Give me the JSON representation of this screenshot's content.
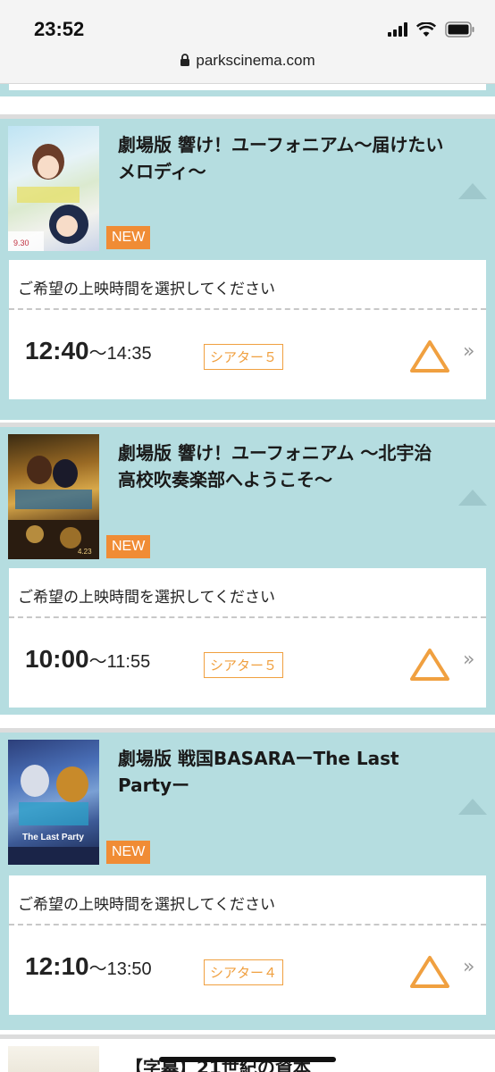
{
  "status": {
    "time": "23:52",
    "url": "parkscinema.com"
  },
  "movies": [
    {
      "title": "劇場版 響け！ユーフォニアム〜届けたいメロディ〜",
      "badge": "NEW",
      "prompt": "ご希望の上映時間を選択してください",
      "start": "12:40",
      "tilde": "〜",
      "end": "14:35",
      "theater": "シアター５",
      "availability_icon": "triangle-icon",
      "more_icon": "double-chevron-right-icon"
    },
    {
      "title": "劇場版 響け！ユーフォニアム 〜北宇治高校吹奏楽部へようこそ〜",
      "badge": "NEW",
      "prompt": "ご希望の上映時間を選択してください",
      "start": "10:00",
      "tilde": "〜",
      "end": "11:55",
      "theater": "シアター５",
      "availability_icon": "triangle-icon",
      "more_icon": "double-chevron-right-icon"
    },
    {
      "title": "劇場版 戦国BASARAーThe Last Partyー",
      "badge": "NEW",
      "prompt": "ご希望の上映時間を選択してください",
      "start": "12:10",
      "tilde": "〜",
      "end": "13:50",
      "theater": "シアター４",
      "availability_icon": "triangle-icon",
      "more_icon": "double-chevron-right-icon"
    }
  ],
  "next_movie": {
    "title": "【字幕】21世紀の資本"
  },
  "colors": {
    "card_bg": "#b5dde0",
    "accent": "#f08c35",
    "triangle": "#f0a040"
  }
}
